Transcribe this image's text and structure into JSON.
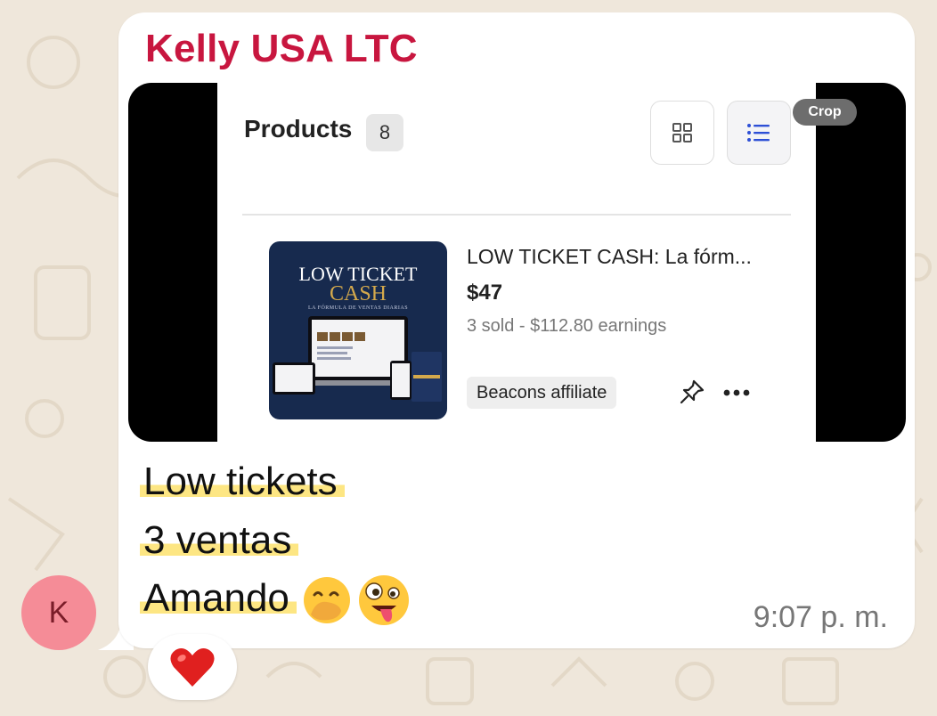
{
  "chat": {
    "sender_name": "Kelly USA LTC",
    "avatar_initial": "K",
    "time": "9:07 p. m.",
    "lines": [
      "Low tickets",
      "3 ventas",
      "Amando"
    ],
    "reaction_emoji": "heart-emoji"
  },
  "screenshot": {
    "crop_label": "Crop",
    "products_title": "Products",
    "products_count": "8",
    "product": {
      "name": "LOW TICKET CASH: La fórm...",
      "price": "$47",
      "stats": "3 sold - $112.80 earnings",
      "tag": "Beacons affiliate",
      "thumb_title_1": "LOW TICKET",
      "thumb_title_2": "CASH",
      "thumb_subtitle": "LA FÓRMULA DE VENTAS DIARIAS"
    }
  },
  "colors": {
    "sender": "#c8163f",
    "bubble": "#ffffff",
    "wallpaper": "#efe7db",
    "highlight": "#fde683",
    "avatar": "#f58c97"
  }
}
